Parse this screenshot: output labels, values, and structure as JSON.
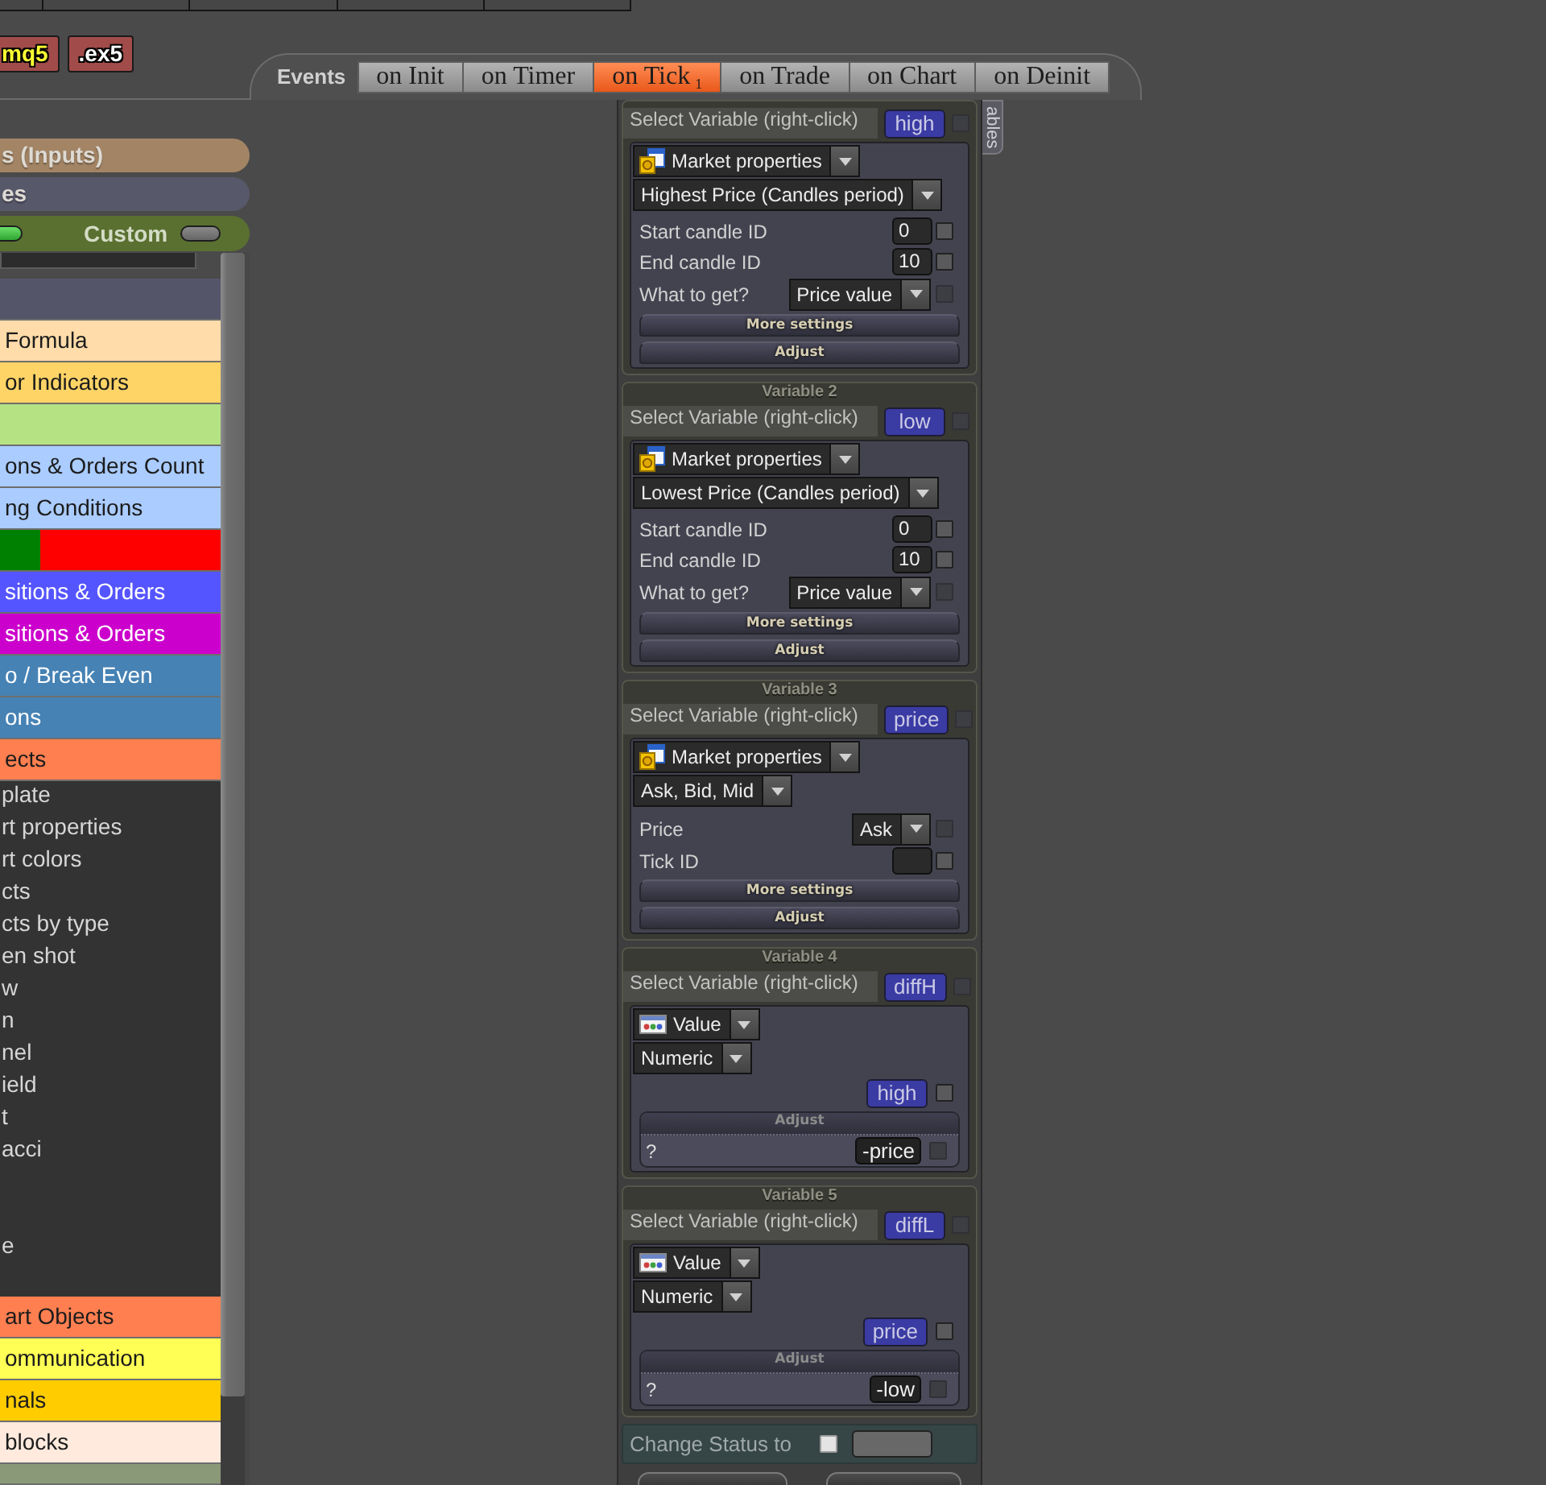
{
  "toolbar": {
    "buttons": [
      {
        "label": "mq5",
        "selected": true
      },
      {
        "label": ".ex5",
        "selected": false
      }
    ]
  },
  "events": {
    "label": "Events",
    "tabs": [
      {
        "label": "on Init",
        "selected": false
      },
      {
        "label": "on Timer",
        "selected": false
      },
      {
        "label": "on Tick$_{1}$",
        "selected": true
      },
      {
        "label": "on Trade",
        "selected": false
      },
      {
        "label": "on Chart",
        "selected": false
      },
      {
        "label": "on Deinit",
        "selected": false
      }
    ]
  },
  "sidebar": {
    "sections": [
      {
        "label": "s (Inputs)",
        "color": "#a38565"
      },
      {
        "label": "es",
        "color": "#58586b"
      }
    ],
    "mode_bar": {
      "items": [
        {
          "kind": "switch",
          "on": true
        },
        {
          "kind": "label",
          "text": "Custom"
        },
        {
          "kind": "switch",
          "on": false
        }
      ]
    },
    "categories": [
      {
        "kind": "row",
        "color": "#55556a"
      },
      {
        "kind": "row",
        "label": "Formula",
        "color": "#ffdcaa"
      },
      {
        "kind": "row",
        "label": "or Indicators",
        "color": "#ffd466"
      },
      {
        "kind": "row",
        "color": "#b5e384"
      },
      {
        "kind": "row",
        "label": "ons & Orders Count",
        "color": "#aaccff"
      },
      {
        "kind": "row",
        "label": "ng Conditions",
        "color": "#aaccff"
      },
      {
        "kind": "split",
        "segments": [
          {
            "color": "#008000"
          },
          {
            "color": "#ff0000"
          }
        ]
      },
      {
        "kind": "row",
        "label": "sitions & Orders",
        "color": "#5555ff"
      },
      {
        "kind": "row",
        "label": "sitions & Orders",
        "color": "#cc00cc"
      },
      {
        "kind": "row",
        "label": "o / Break Even",
        "color": "#4682b4"
      },
      {
        "kind": "row",
        "label": "ons",
        "color": "#4682b4"
      },
      {
        "kind": "row",
        "label": "ects",
        "color": "#ff7f50",
        "children": [
          {
            "kind": "item",
            "label": "plate"
          },
          {
            "kind": "item",
            "label": "rt properties"
          },
          {
            "kind": "item",
            "label": "rt colors"
          },
          {
            "kind": "item",
            "label": "cts"
          },
          {
            "kind": "item",
            "label": "cts by type"
          },
          {
            "kind": "item",
            "label": "en shot"
          },
          {
            "kind": "item",
            "label": "w"
          },
          {
            "kind": "item",
            "label": "n"
          },
          {
            "kind": "item",
            "label": "nel"
          },
          {
            "kind": "item",
            "label": "ield"
          },
          {
            "kind": "item",
            "label": "t"
          },
          {
            "kind": "item",
            "label": "acci"
          },
          {
            "kind": "blank"
          },
          {
            "kind": "blank"
          },
          {
            "kind": "item",
            "label": "e"
          },
          {
            "kind": "blank"
          }
        ]
      },
      {
        "kind": "row",
        "label": "art Objects",
        "color": "#ff7f50"
      },
      {
        "kind": "row",
        "label": "ommunication",
        "color": "#ffff55"
      },
      {
        "kind": "row",
        "label": "nals",
        "color": "#ffcc00"
      },
      {
        "kind": "row",
        "label": "blocks",
        "color": "#ffeadd"
      },
      {
        "kind": "row",
        "color": "#8a9a78"
      }
    ]
  },
  "panel": {
    "side_tab": "ables",
    "variables": [
      {
        "select_label": "Select Variable (right-click)",
        "name": "high",
        "name_checkbox": {
          "checked": false,
          "disabled": true
        },
        "source": {
          "kind": "market",
          "label": "Market properties"
        },
        "mode": "Highest Price (Candles period)",
        "fields": [
          {
            "kind": "number",
            "label": "Start candle ID",
            "value": "0",
            "checkbox": {
              "checked": false,
              "disabled": false
            }
          },
          {
            "kind": "number",
            "label": "End candle ID",
            "value": "10",
            "checkbox": {
              "checked": false,
              "disabled": false
            }
          },
          {
            "kind": "select",
            "label": "What to get?",
            "value": "Price value",
            "checkbox": {
              "checked": false,
              "disabled": true
            }
          }
        ],
        "buttons": [
          "More settings",
          "Adjust"
        ]
      },
      {
        "title": "Variable 2",
        "select_label": "Select Variable (right-click)",
        "name": "low",
        "name_checkbox": {
          "checked": false,
          "disabled": true
        },
        "source": {
          "kind": "market",
          "label": "Market properties"
        },
        "mode": "Lowest Price (Candles period)",
        "fields": [
          {
            "kind": "number",
            "label": "Start candle ID",
            "value": "0",
            "checkbox": {
              "checked": false,
              "disabled": false
            }
          },
          {
            "kind": "number",
            "label": "End candle ID",
            "value": "10",
            "checkbox": {
              "checked": false,
              "disabled": false
            }
          },
          {
            "kind": "select",
            "label": "What to get?",
            "value": "Price value",
            "checkbox": {
              "checked": false,
              "disabled": true
            }
          }
        ],
        "buttons": [
          "More settings",
          "Adjust"
        ]
      },
      {
        "title": "Variable 3",
        "select_label": "Select Variable (right-click)",
        "name": "price",
        "name_checkbox": {
          "checked": false,
          "disabled": true
        },
        "source": {
          "kind": "market",
          "label": "Market properties"
        },
        "mode": "Ask, Bid, Mid",
        "fields": [
          {
            "kind": "select",
            "label": "Price",
            "value": "Ask",
            "checkbox": {
              "checked": false,
              "disabled": true
            }
          },
          {
            "kind": "number",
            "label": "Tick ID",
            "checkbox": {
              "checked": false,
              "disabled": false
            }
          }
        ],
        "buttons": [
          "More settings",
          "Adjust"
        ]
      },
      {
        "title": "Variable 4",
        "select_label": "Select Variable (right-click)",
        "name": "diffH",
        "name_checkbox": {
          "checked": false,
          "disabled": true
        },
        "source": {
          "kind": "value",
          "label": "Value"
        },
        "mode": "Numeric",
        "operand": {
          "label": "high",
          "checkbox": {
            "checked": false,
            "disabled": false
          }
        },
        "adjust": {
          "title": "Adjust",
          "prefix": "?",
          "value": "-price",
          "checkbox": {
            "checked": false,
            "disabled": true
          }
        }
      },
      {
        "title": "Variable 5",
        "select_label": "Select Variable (right-click)",
        "name": "diffL",
        "name_checkbox": {
          "checked": false,
          "disabled": true
        },
        "source": {
          "kind": "value",
          "label": "Value"
        },
        "mode": "Numeric",
        "operand": {
          "label": "price",
          "checkbox": {
            "checked": false,
            "disabled": false
          }
        },
        "adjust": {
          "title": "Adjust",
          "prefix": "?",
          "value": "-low",
          "checkbox": {
            "checked": false,
            "disabled": true
          }
        }
      }
    ],
    "change_status": {
      "label": "Change Status to",
      "checked": false
    }
  }
}
